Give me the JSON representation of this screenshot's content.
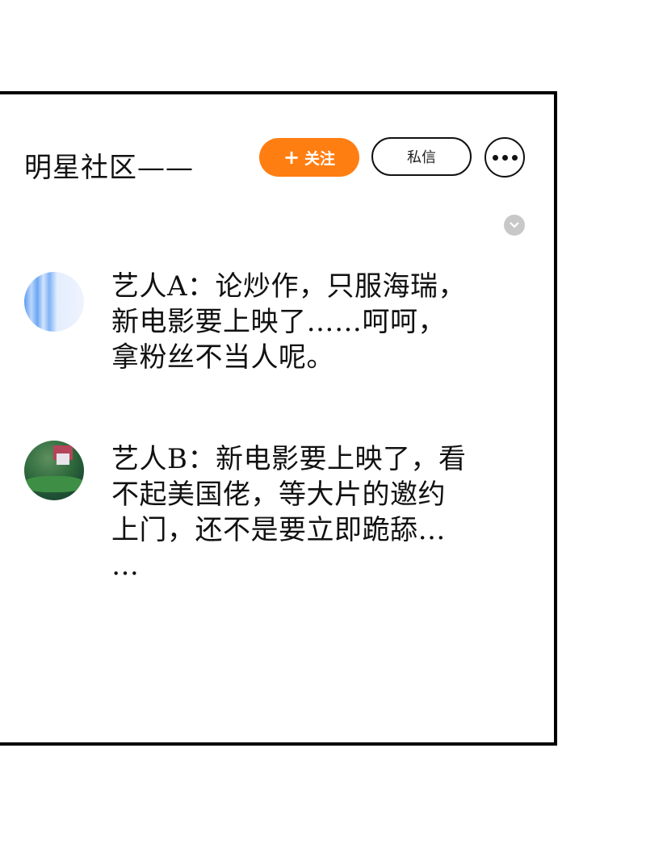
{
  "header": {
    "title": "明星社区——",
    "follow_label": "关注",
    "follow_plus": "+",
    "dm_label": "私信"
  },
  "posts": [
    {
      "lines": [
        "艺人A：论炒作，只服海瑞，",
        "新电影要上映了……呵呵，",
        "拿粉丝不当人呢。"
      ]
    },
    {
      "lines": [
        "艺人B：新电影要上映了，看",
        "不起美国佬，等大片的邀约",
        "上门，还不是要立即跪舔…",
        "…"
      ]
    }
  ],
  "colors": {
    "accent": "#ff7e12",
    "border": "#000000",
    "collapse": "#c8c8c8"
  },
  "icons": {
    "more": "more-dots-icon",
    "collapse": "chevron-down-icon"
  }
}
